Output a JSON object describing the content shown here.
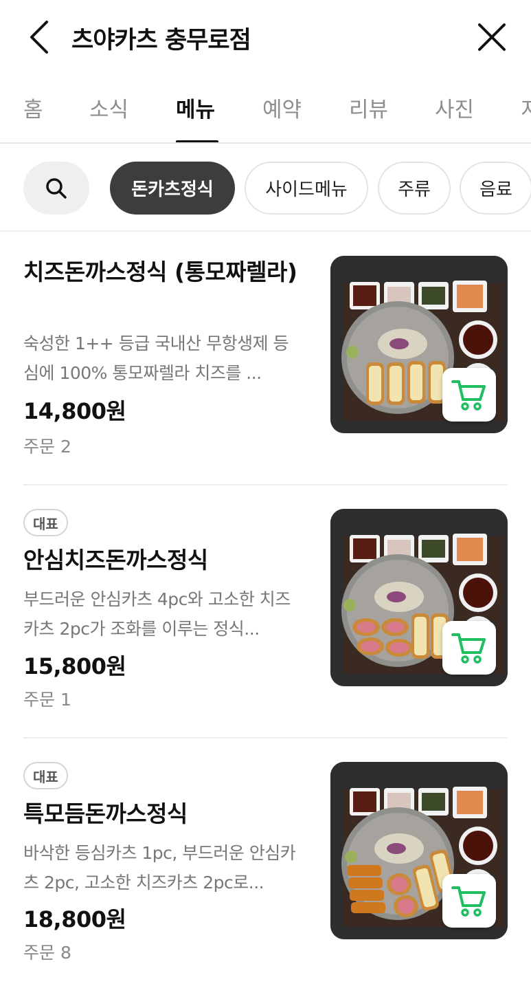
{
  "header": {
    "title": "츠야카츠 충무로점"
  },
  "tabs": [
    {
      "label": "홈",
      "active": false
    },
    {
      "label": "소식",
      "active": false
    },
    {
      "label": "메뉴",
      "active": true
    },
    {
      "label": "예약",
      "active": false
    },
    {
      "label": "리뷰",
      "active": false
    },
    {
      "label": "사진",
      "active": false
    },
    {
      "label": "지",
      "active": false
    }
  ],
  "categories": [
    {
      "label": "돈카츠정식",
      "active": true
    },
    {
      "label": "사이드메뉴",
      "active": false
    },
    {
      "label": "주류",
      "active": false
    },
    {
      "label": "음료",
      "active": false
    }
  ],
  "menu_items": [
    {
      "badge": "",
      "name": "치즈돈까스정식 (통모짜렐라)",
      "description": "숙성한 1++ 등급 국내산 무항생제 등심에 100% 통모짜렐라 치즈를 ...",
      "price": "14,800원",
      "orders": "주문 2"
    },
    {
      "badge": "대표",
      "name": "안심치즈돈까스정식",
      "description": "부드러운 안심카츠 4pc와 고소한 치즈카츠 2pc가 조화를 이루는 정식...",
      "price": "15,800원",
      "orders": "주문 1"
    },
    {
      "badge": "대표",
      "name": "특모듬돈까스정식",
      "description": "바삭한 등심카츠 1pc, 부드러운 안심카츠 2pc, 고소한 치즈카츠 2pc로...",
      "price": "18,800원",
      "orders": "주문 8"
    }
  ],
  "icons": {
    "back": "chevron-left-icon",
    "close": "close-icon",
    "search": "search-icon",
    "cart": "cart-icon"
  },
  "colors": {
    "active_chip_bg": "#3d3d3d",
    "cart_icon": "#1fbf5f",
    "tab_active": "#111111",
    "tab_inactive": "#8e8e8e"
  }
}
